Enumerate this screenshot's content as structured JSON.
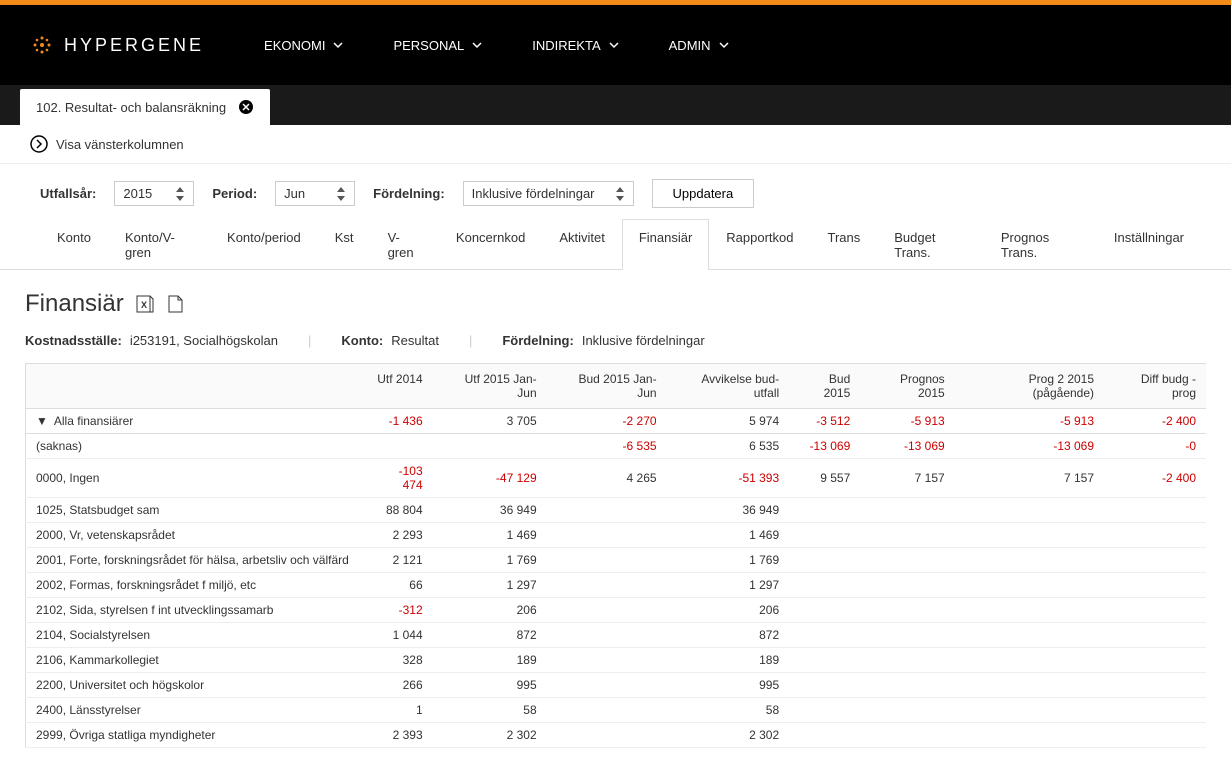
{
  "brand": "HYPERGENE",
  "nav": [
    "EKONOMI",
    "PERSONAL",
    "INDIREKTA",
    "ADMIN"
  ],
  "open_tab": "102. Resultat- och balansräkning",
  "show_left_col": "Visa vänsterkolumnen",
  "filters": {
    "utfallsar_label": "Utfallsår:",
    "utfallsar_value": "2015",
    "period_label": "Period:",
    "period_value": "Jun",
    "fordelning_label": "Fördelning:",
    "fordelning_value": "Inklusive fördelningar",
    "update_btn": "Uppdatera"
  },
  "tabs": [
    "Konto",
    "Konto/V-gren",
    "Konto/period",
    "Kst",
    "V-gren",
    "Koncernkod",
    "Aktivitet",
    "Finansiär",
    "Rapportkod",
    "Trans",
    "Budget Trans.",
    "Prognos Trans.",
    "Inställningar"
  ],
  "active_tab": "Finansiär",
  "page_title": "Finansiär",
  "meta": {
    "kst_label": "Kostnadsställe:",
    "kst_value": "i253191, Socialhögskolan",
    "konto_label": "Konto:",
    "konto_value": "Resultat",
    "ford_label": "Fördelning:",
    "ford_value": "Inklusive fördelningar"
  },
  "columns": [
    "",
    "Utf 2014",
    "Utf 2015 Jan- Jun",
    "Bud 2015 Jan- Jun",
    "Avvikelse bud-utfall",
    "Bud 2015",
    "Prognos 2015",
    "Prog 2 2015 (pågående)",
    "Diff budg - prog"
  ],
  "rows": [
    {
      "label": "Alla finansiärer",
      "indent": 0,
      "expand": true,
      "cells": [
        "-1 436",
        "3 705",
        "-2 270",
        "5 974",
        "-3 512",
        "-5 913",
        "-5 913",
        "-2 400"
      ]
    },
    {
      "label": "(saknas)",
      "indent": 1,
      "cells": [
        "",
        "",
        "-6 535",
        "6 535",
        "-13 069",
        "-13 069",
        "-13 069",
        "-0"
      ]
    },
    {
      "label": "0000, Ingen",
      "indent": 1,
      "cells": [
        "-103 474",
        "-47 129",
        "4 265",
        "-51 393",
        "9 557",
        "7 157",
        "7 157",
        "-2 400"
      ]
    },
    {
      "label": "1025, Statsbudget sam",
      "indent": 1,
      "cells": [
        "88 804",
        "36 949",
        "",
        "36 949",
        "",
        "",
        "",
        ""
      ]
    },
    {
      "label": "2000, Vr, vetenskapsrådet",
      "indent": 1,
      "cells": [
        "2 293",
        "1 469",
        "",
        "1 469",
        "",
        "",
        "",
        ""
      ]
    },
    {
      "label": "2001, Forte, forskningsrådet för hälsa, arbetsliv och välfärd",
      "indent": 1,
      "cells": [
        "2 121",
        "1 769",
        "",
        "1 769",
        "",
        "",
        "",
        ""
      ]
    },
    {
      "label": "2002, Formas, forskningsrådet f miljö, etc",
      "indent": 1,
      "cells": [
        "66",
        "1 297",
        "",
        "1 297",
        "",
        "",
        "",
        ""
      ]
    },
    {
      "label": "2102, Sida, styrelsen f int utvecklingssamarb",
      "indent": 1,
      "cells": [
        "-312",
        "206",
        "",
        "206",
        "",
        "",
        "",
        ""
      ]
    },
    {
      "label": "2104, Socialstyrelsen",
      "indent": 1,
      "cells": [
        "1 044",
        "872",
        "",
        "872",
        "",
        "",
        "",
        ""
      ]
    },
    {
      "label": "2106, Kammarkollegiet",
      "indent": 1,
      "cells": [
        "328",
        "189",
        "",
        "189",
        "",
        "",
        "",
        ""
      ]
    },
    {
      "label": "2200, Universitet och högskolor",
      "indent": 1,
      "cells": [
        "266",
        "995",
        "",
        "995",
        "",
        "",
        "",
        ""
      ]
    },
    {
      "label": "2400, Länsstyrelser",
      "indent": 1,
      "cells": [
        "1",
        "58",
        "",
        "58",
        "",
        "",
        "",
        ""
      ]
    },
    {
      "label": "2999, Övriga statliga myndigheter",
      "indent": 1,
      "cells": [
        "2 393",
        "2 302",
        "",
        "2 302",
        "",
        "",
        "",
        ""
      ]
    }
  ]
}
